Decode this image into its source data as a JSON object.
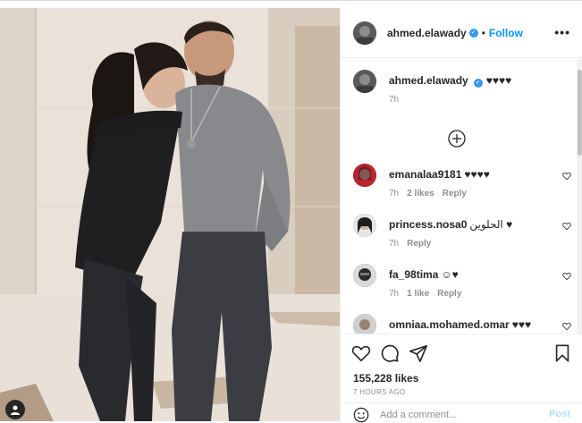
{
  "post": {
    "username": "ahmed.elawady",
    "verified_mark": "✓",
    "separator": "•",
    "follow_label": "Follow",
    "more_label": "•••",
    "caption": "♥♥♥♥",
    "caption_time": "7h"
  },
  "comments": [
    {
      "username": "emanalaa9181",
      "text": "♥♥♥♥",
      "time": "7h",
      "likes": "2 likes",
      "reply": "Reply"
    },
    {
      "username": "princess.nosa0",
      "text": "الحلوين ♥",
      "time": "7h",
      "likes": "",
      "reply": "Reply"
    },
    {
      "username": "fa_98tima",
      "text": "☺♥",
      "time": "7h",
      "likes": "1 like",
      "reply": "Reply"
    },
    {
      "username": "omniaa.mohamed.omar",
      "text": "♥♥♥",
      "time": "",
      "likes": "",
      "reply": ""
    }
  ],
  "actions": {
    "like_icon": "heart-outline",
    "comment_icon": "speech-bubble",
    "share_icon": "paper-plane",
    "save_icon": "bookmark",
    "likes_count": "155,228 likes",
    "time_ago": "7 HOURS AGO"
  },
  "composer": {
    "emoji_icon": "smiley",
    "placeholder": "Add a comment...",
    "post_label": "Post"
  },
  "colors": {
    "accent": "#0095f6",
    "verified": "#3897f0",
    "muted": "#8e8e8e",
    "post_disabled": "#b2dffc"
  }
}
